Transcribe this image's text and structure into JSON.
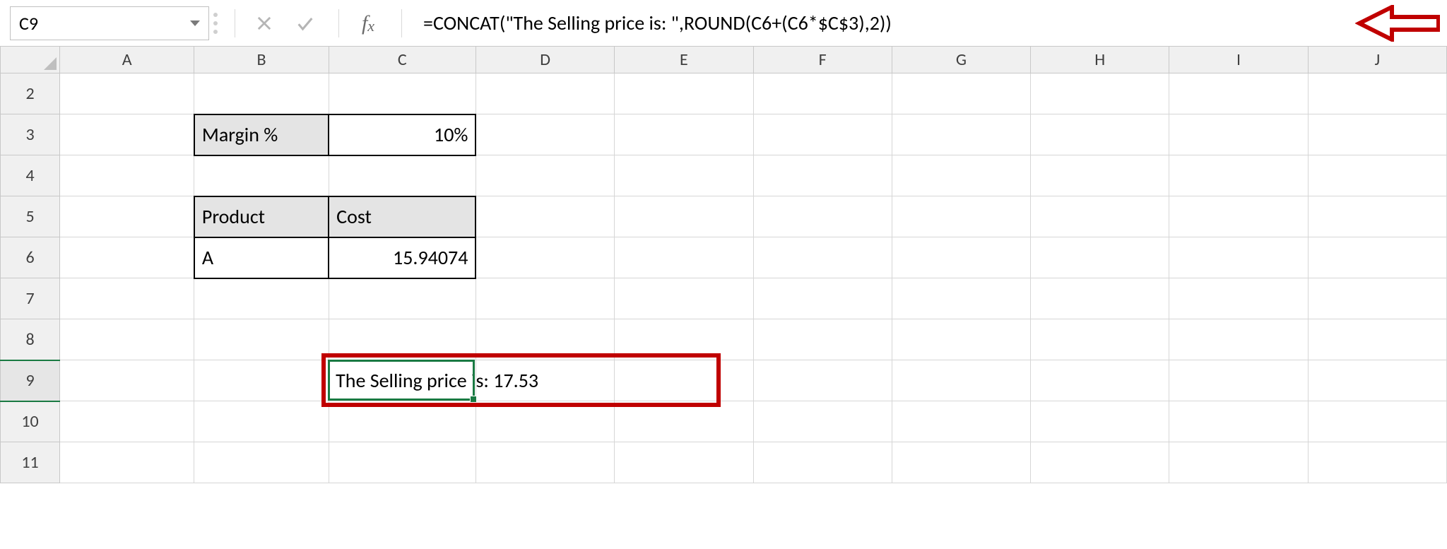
{
  "name_box": {
    "value": "C9"
  },
  "formula_bar": {
    "value": "=CONCAT(\"The Selling price is: \",ROUND(C6+(C6*$C$3),2))"
  },
  "columns": [
    "A",
    "B",
    "C",
    "D",
    "E",
    "F",
    "G",
    "H",
    "I",
    "J"
  ],
  "rows": [
    "2",
    "3",
    "4",
    "5",
    "6",
    "7",
    "8",
    "9",
    "10",
    "11"
  ],
  "cells": {
    "B3": "Margin %",
    "C3": "10%",
    "B5": "Product",
    "C5": "Cost",
    "B6": "A",
    "C6": "15.94074",
    "C9": "The Selling price is: 17.53"
  }
}
